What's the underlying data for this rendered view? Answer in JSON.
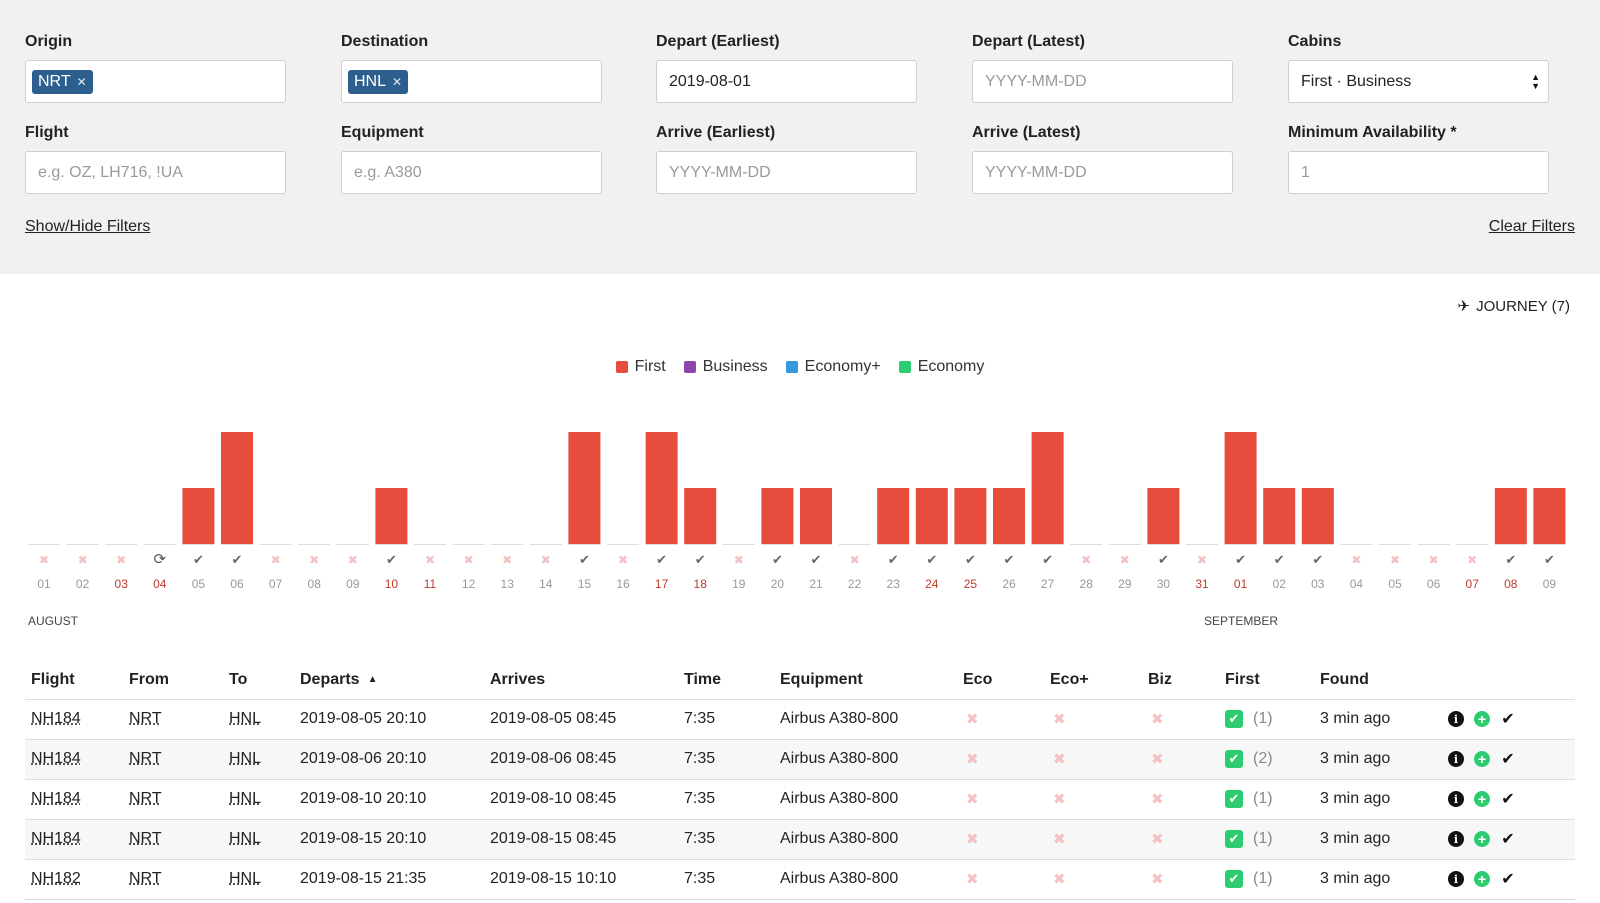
{
  "filters": {
    "origin": {
      "label": "Origin",
      "tag": "NRT"
    },
    "destination": {
      "label": "Destination",
      "tag": "HNL"
    },
    "depart_earliest": {
      "label": "Depart (Earliest)",
      "value": "2019-08-01"
    },
    "depart_latest": {
      "label": "Depart (Latest)",
      "placeholder": "YYYY-MM-DD"
    },
    "cabins": {
      "label": "Cabins",
      "value": "First · Business"
    },
    "flight": {
      "label": "Flight",
      "placeholder": "e.g. OZ, LH716, !UA"
    },
    "equipment": {
      "label": "Equipment",
      "placeholder": "e.g. A380"
    },
    "arrive_earliest": {
      "label": "Arrive (Earliest)",
      "placeholder": "YYYY-MM-DD"
    },
    "arrive_latest": {
      "label": "Arrive (Latest)",
      "placeholder": "YYYY-MM-DD"
    },
    "min_avail": {
      "label": "Minimum Availability *",
      "value": "1"
    },
    "show_hide": "Show/Hide Filters",
    "clear": "Clear Filters"
  },
  "journey": "JOURNEY (7)",
  "legend": [
    {
      "label": "First",
      "color": "#e74c3c"
    },
    {
      "label": "Business",
      "color": "#8e44ad"
    },
    {
      "label": "Economy+",
      "color": "#3498db"
    },
    {
      "label": "Economy",
      "color": "#2ecc71"
    }
  ],
  "chart_data": {
    "type": "bar",
    "series": [
      {
        "name": "First",
        "color": "#e74c3c"
      }
    ],
    "days": [
      {
        "d": "01",
        "v": 0,
        "s": "x",
        "red": false
      },
      {
        "d": "02",
        "v": 0,
        "s": "x",
        "red": false
      },
      {
        "d": "03",
        "v": 0,
        "s": "x",
        "red": true
      },
      {
        "d": "04",
        "v": 0,
        "s": "refresh",
        "red": true
      },
      {
        "d": "05",
        "v": 1,
        "s": "check",
        "red": false
      },
      {
        "d": "06",
        "v": 2,
        "s": "check",
        "red": false
      },
      {
        "d": "07",
        "v": 0,
        "s": "x",
        "red": false
      },
      {
        "d": "08",
        "v": 0,
        "s": "x",
        "red": false
      },
      {
        "d": "09",
        "v": 0,
        "s": "x",
        "red": false
      },
      {
        "d": "10",
        "v": 1,
        "s": "check",
        "red": true
      },
      {
        "d": "11",
        "v": 0,
        "s": "x",
        "red": true
      },
      {
        "d": "12",
        "v": 0,
        "s": "x",
        "red": false
      },
      {
        "d": "13",
        "v": 0,
        "s": "x",
        "red": false
      },
      {
        "d": "14",
        "v": 0,
        "s": "x",
        "red": false
      },
      {
        "d": "15",
        "v": 2,
        "s": "check",
        "red": false
      },
      {
        "d": "16",
        "v": 0,
        "s": "x",
        "red": false
      },
      {
        "d": "17",
        "v": 2,
        "s": "check",
        "red": true
      },
      {
        "d": "18",
        "v": 1,
        "s": "check",
        "red": true
      },
      {
        "d": "19",
        "v": 0,
        "s": "x",
        "red": false
      },
      {
        "d": "20",
        "v": 1,
        "s": "check",
        "red": false
      },
      {
        "d": "21",
        "v": 1,
        "s": "check",
        "red": false
      },
      {
        "d": "22",
        "v": 0,
        "s": "x",
        "red": false
      },
      {
        "d": "23",
        "v": 1,
        "s": "check",
        "red": false
      },
      {
        "d": "24",
        "v": 1,
        "s": "check",
        "red": true
      },
      {
        "d": "25",
        "v": 1,
        "s": "check",
        "red": true
      },
      {
        "d": "26",
        "v": 1,
        "s": "check",
        "red": false
      },
      {
        "d": "27",
        "v": 2,
        "s": "check",
        "red": false
      },
      {
        "d": "28",
        "v": 0,
        "s": "x",
        "red": false
      },
      {
        "d": "29",
        "v": 0,
        "s": "x",
        "red": false
      },
      {
        "d": "30",
        "v": 1,
        "s": "check",
        "red": false
      },
      {
        "d": "31",
        "v": 0,
        "s": "x",
        "red": true
      },
      {
        "d": "01",
        "v": 2,
        "s": "check",
        "red": true
      },
      {
        "d": "02",
        "v": 1,
        "s": "check",
        "red": false
      },
      {
        "d": "03",
        "v": 1,
        "s": "check",
        "red": false
      },
      {
        "d": "04",
        "v": 0,
        "s": "x",
        "red": false
      },
      {
        "d": "05",
        "v": 0,
        "s": "x",
        "red": false
      },
      {
        "d": "06",
        "v": 0,
        "s": "x",
        "red": false
      },
      {
        "d": "07",
        "v": 0,
        "s": "x",
        "red": true
      },
      {
        "d": "08",
        "v": 1,
        "s": "check",
        "red": true
      },
      {
        "d": "09",
        "v": 1,
        "s": "check",
        "red": false
      }
    ],
    "months": [
      "AUGUST",
      "SEPTEMBER"
    ],
    "ylim": [
      0,
      2
    ]
  },
  "table": {
    "headers": [
      "Flight",
      "From",
      "To",
      "Departs",
      "Arrives",
      "Time",
      "Equipment",
      "Eco",
      "Eco+",
      "Biz",
      "First",
      "Found"
    ],
    "rows": [
      {
        "flight": "NH184",
        "from": "NRT",
        "to": "HNL",
        "departs": "2019-08-05 20:10",
        "arrives": "2019-08-05 08:45",
        "time": "7:35",
        "equipment": "Airbus A380-800",
        "first": "(1)",
        "found": "3 min ago"
      },
      {
        "flight": "NH184",
        "from": "NRT",
        "to": "HNL",
        "departs": "2019-08-06 20:10",
        "arrives": "2019-08-06 08:45",
        "time": "7:35",
        "equipment": "Airbus A380-800",
        "first": "(2)",
        "found": "3 min ago"
      },
      {
        "flight": "NH184",
        "from": "NRT",
        "to": "HNL",
        "departs": "2019-08-10 20:10",
        "arrives": "2019-08-10 08:45",
        "time": "7:35",
        "equipment": "Airbus A380-800",
        "first": "(1)",
        "found": "3 min ago"
      },
      {
        "flight": "NH184",
        "from": "NRT",
        "to": "HNL",
        "departs": "2019-08-15 20:10",
        "arrives": "2019-08-15 08:45",
        "time": "7:35",
        "equipment": "Airbus A380-800",
        "first": "(1)",
        "found": "3 min ago"
      },
      {
        "flight": "NH182",
        "from": "NRT",
        "to": "HNL",
        "departs": "2019-08-15 21:35",
        "arrives": "2019-08-15 10:10",
        "time": "7:35",
        "equipment": "Airbus A380-800",
        "first": "(1)",
        "found": "3 min ago"
      }
    ]
  }
}
